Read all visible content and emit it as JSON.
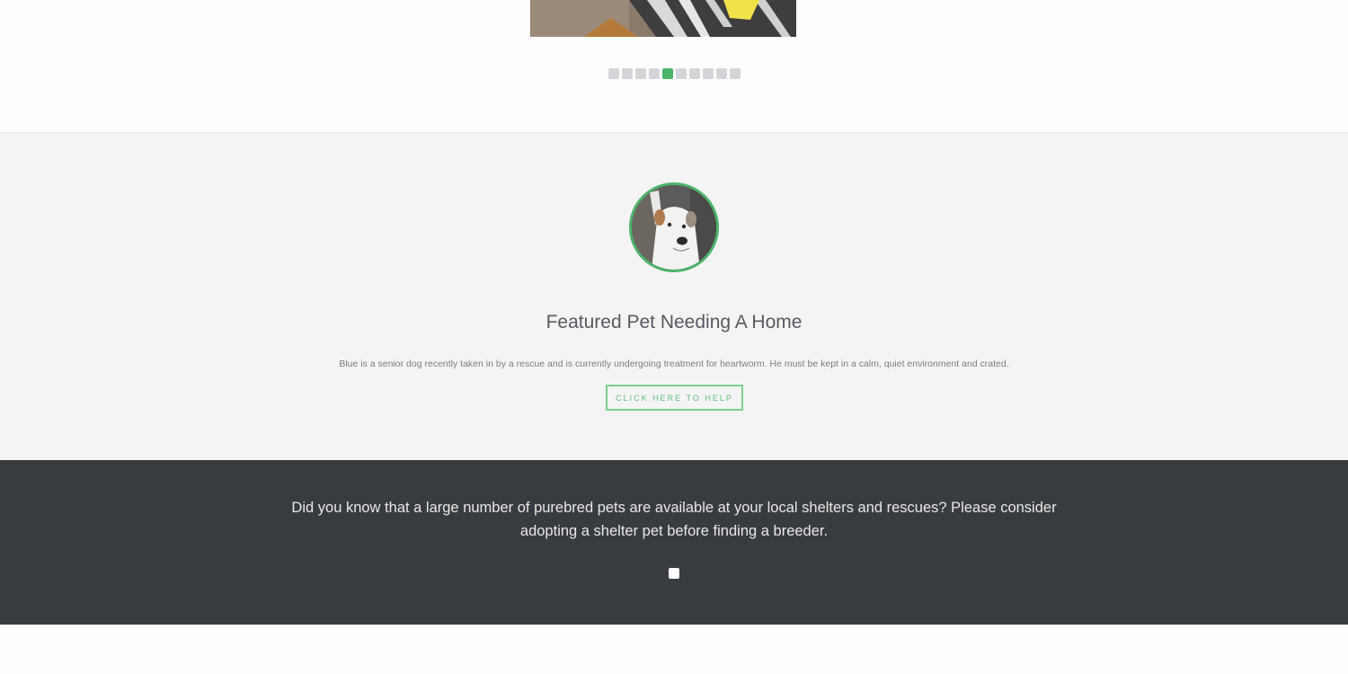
{
  "slider": {
    "dot_count": 10,
    "active_index": 4,
    "active_color": "#4cb36a",
    "inactive_color": "#d3d5d8"
  },
  "featured": {
    "title": "Featured Pet Needing A Home",
    "description": "Blue is a senior dog recently taken in by a rescue and is currently undergoing treatment for heartworm. He must be kept in a calm, quiet environment and crated.",
    "button_label": "CLICK HERE TO HELP",
    "accent_color": "#4cb36a"
  },
  "banner": {
    "text": "Did you know that a large number of purebred pets are available at your local shelters and rescues?  Please consider adopting a shelter pet before finding a breeder.",
    "background_color": "#383c40"
  }
}
